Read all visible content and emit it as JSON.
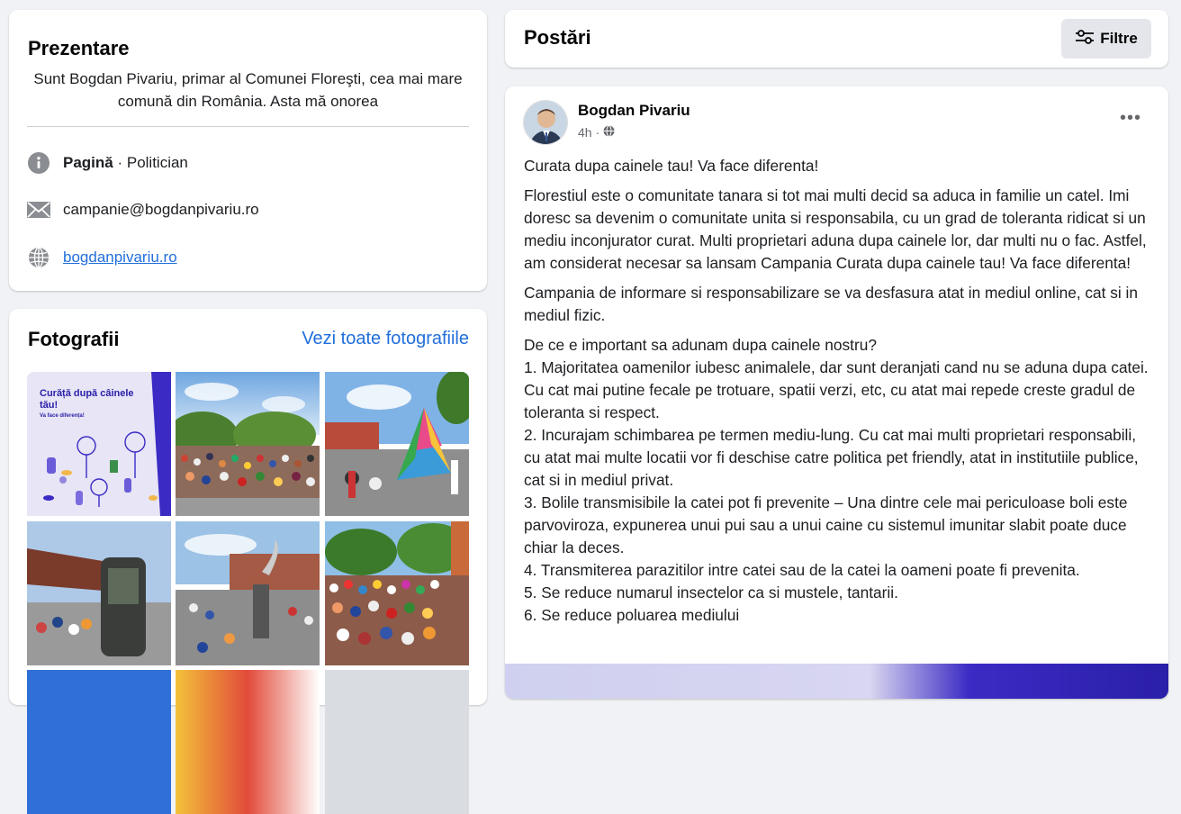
{
  "intro": {
    "title": "Prezentare",
    "bio": "Sunt Bogdan Pivariu, primar al Comunei Floreşti, cea mai mare comună din România. Asta mă onorea",
    "page_label": "Pagină",
    "page_category": " · Politician",
    "email": "campanie@bogdanpivariu.ro",
    "website": "bogdanpivariu.ro"
  },
  "photos": {
    "title": "Fotografii",
    "see_all": "Vezi toate fotografiile",
    "poster_title": "Curăță după câinele tău!",
    "poster_sub": "Va face diferența!"
  },
  "posts_header": {
    "title": "Postări",
    "filter_label": "Filtre"
  },
  "post": {
    "author": "Bogdan Pivariu",
    "time": "4h",
    "paragraphs": [
      "Curata dupa cainele tau! Va face diferenta!",
      "Florestiul este o comunitate tanara si tot mai multi decid sa aduca in familie un catel. Imi doresc sa devenim o comunitate unita si responsabila, cu un grad de toleranta ridicat si un mediu inconjurator curat. Multi proprietari aduna dupa cainele lor, dar multi nu o fac. Astfel, am considerat necesar sa lansam Campania Curata dupa cainele tau! Va face diferenta!",
      "Campania de informare si responsabilizare se va desfasura atat in mediul online, cat si in mediul fizic.",
      "De ce e important sa adunam dupa cainele nostru?\n1. Majoritatea oamenilor iubesc animalele, dar sunt deranjati cand nu se aduna dupa catei. Cu cat mai putine fecale pe trotuare, spatii verzi, etc, cu atat mai repede creste gradul de toleranta si respect.\n2. Incurajam schimbarea pe termen mediu-lung. Cu cat mai multi proprietari responsabili, cu atat mai multe locatii vor fi deschise catre politica pet friendly, atat in institutiile publice, cat si in mediul privat.\n3. Bolile transmisibile la catei pot fi prevenite – Una dintre cele mai periculoase boli este parvoviroza, expunerea unui pui sau a unui caine cu sistemul imunitar slabit poate duce chiar la deces.\n4. Transmiterea parazitilor intre catei sau de la catei la oameni poate fi prevenita.\n5. Se reduce numarul insectelor ca si mustele, tantarii.\n6. Se reduce poluarea mediului"
    ]
  },
  "colors": {
    "link": "#216fdb",
    "background": "#f0f2f5",
    "poster_accent": "#3b2bc4"
  }
}
